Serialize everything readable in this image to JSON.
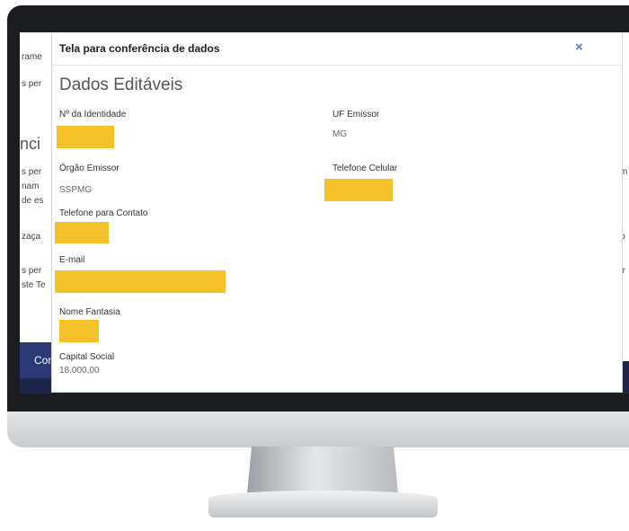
{
  "background": {
    "lines": [
      "rame",
      "s per",
      "s per",
      "nam",
      "de es",
      "zaça",
      "s per",
      "ste Te",
      "a em",
      "des",
      "isito",
      "oder"
    ],
    "headings": [
      "nci",
      "nc"
    ],
    "button_label": "Con"
  },
  "modal": {
    "title": "Tela para conferência de dados",
    "close_glyph": "×",
    "section_title": "Dados Editáveis",
    "fields": {
      "identidade": {
        "label": "Nº da Identidade"
      },
      "uf_emissor": {
        "label": "UF Emissor",
        "value": "MG"
      },
      "orgao_emissor": {
        "label": "Órgão Emissor",
        "value": "SSPMG"
      },
      "telefone_celular": {
        "label": "Telefone Celular"
      },
      "telefone_contato": {
        "label": "Telefone para Contato"
      },
      "email": {
        "label": "E-mail"
      },
      "nome_fantasia": {
        "label": "Nome Fantasia"
      },
      "capital_social": {
        "label": "Capital Social",
        "value": "18.000,00"
      }
    }
  },
  "colors": {
    "redaction": "#f6c22c",
    "close_icon": "#4a86c5",
    "navy": "#1c2547"
  }
}
